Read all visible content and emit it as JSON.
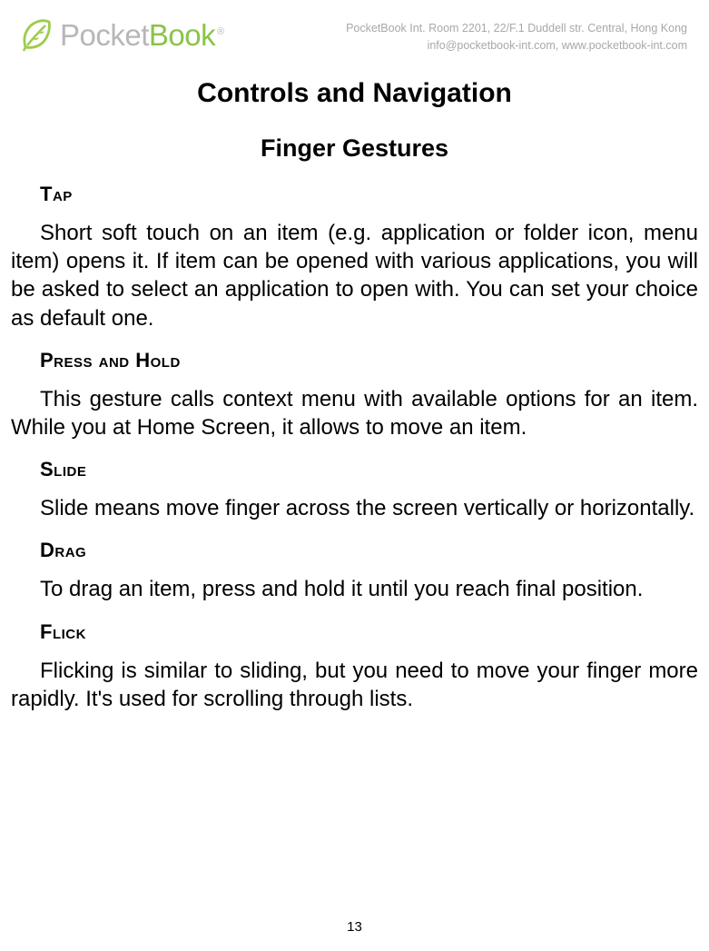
{
  "header": {
    "logo_word1": "Pocket",
    "logo_word2": "Book",
    "trademark": "®",
    "address_line1": "PocketBook Int. Room 2201, 22/F.1 Duddell str. Central, Hong Kong",
    "address_line2": "info@pocketbook-int.com, www.pocketbook-int.com"
  },
  "title": "Controls and Navigation",
  "subtitle": "Finger Gestures",
  "sections": [
    {
      "label": "Tap",
      "body": "Short soft touch on an item (e.g. application or folder icon, menu item) opens it. If item can be opened with various applications, you will be asked to select an application to open with. You can set your choice as default one."
    },
    {
      "label": "Press and Hold",
      "body": "This gesture calls context menu with available options for an item. While you at Home Screen, it allows to move an item."
    },
    {
      "label": "Slide",
      "body": "Slide means move finger across the screen vertically or horizontally."
    },
    {
      "label": "Drag",
      "body": "To drag an item, press and hold it until you reach final position."
    },
    {
      "label": "Flick",
      "body": "Flicking is similar to sliding, but you need to move your finger more rapidly. It's used for scrolling through lists."
    }
  ],
  "page_number": "13"
}
